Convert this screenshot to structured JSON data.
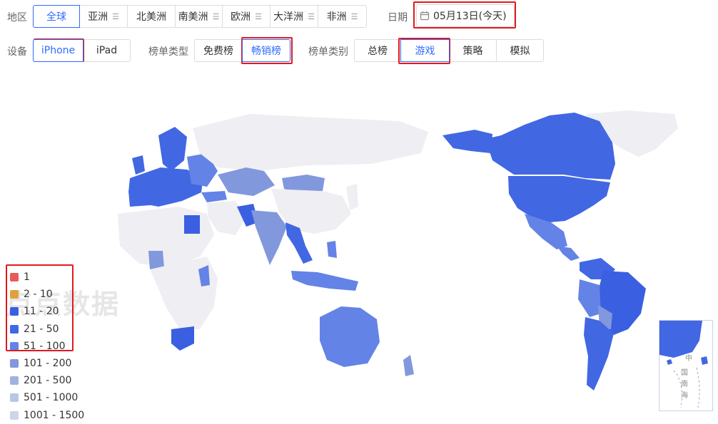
{
  "region": {
    "label": "地区",
    "options": [
      {
        "label": "全球",
        "has_menu": false,
        "active": true
      },
      {
        "label": "亚洲",
        "has_menu": true
      },
      {
        "label": "北美洲",
        "has_menu": true
      },
      {
        "label": "南美洲",
        "has_menu": true
      },
      {
        "label": "欧洲",
        "has_menu": true
      },
      {
        "label": "大洋洲",
        "has_menu": true
      },
      {
        "label": "非洲",
        "has_menu": true
      }
    ]
  },
  "date": {
    "label": "日期",
    "value": "05月13日(今天)"
  },
  "device": {
    "label": "设备",
    "options": [
      {
        "label": "iPhone",
        "active": true
      },
      {
        "label": "iPad"
      }
    ]
  },
  "rank_type": {
    "label": "榜单类型",
    "options": [
      {
        "label": "免费榜"
      },
      {
        "label": "畅销榜",
        "active": true
      }
    ]
  },
  "rank_category": {
    "label": "榜单类别",
    "options": [
      {
        "label": "总榜"
      },
      {
        "label": "游戏",
        "active": true
      },
      {
        "label": "策略"
      },
      {
        "label": "模拟"
      }
    ]
  },
  "legend": [
    {
      "label": "1",
      "color": "#e85a5a"
    },
    {
      "label": "2 - 10",
      "color": "#e0a040"
    },
    {
      "label": "11 - 20",
      "color": "#3a5fe0"
    },
    {
      "label": "21 - 50",
      "color": "#4167e3"
    },
    {
      "label": "51 - 100",
      "color": "#6483e6"
    },
    {
      "label": "101 - 200",
      "color": "#8198dd"
    },
    {
      "label": "201 - 500",
      "color": "#a1b2de"
    },
    {
      "label": "501 - 1000",
      "color": "#b9c6e4"
    },
    {
      "label": "1001 - 1500",
      "color": "#ccd5ea"
    }
  ],
  "watermark": "点点数据",
  "inset_labels": [
    "中",
    "国",
    "南",
    "海"
  ],
  "colors": {
    "accent": "#2f6bff",
    "highlight": "#e0191f",
    "unranked_land": "#eeeef3"
  }
}
